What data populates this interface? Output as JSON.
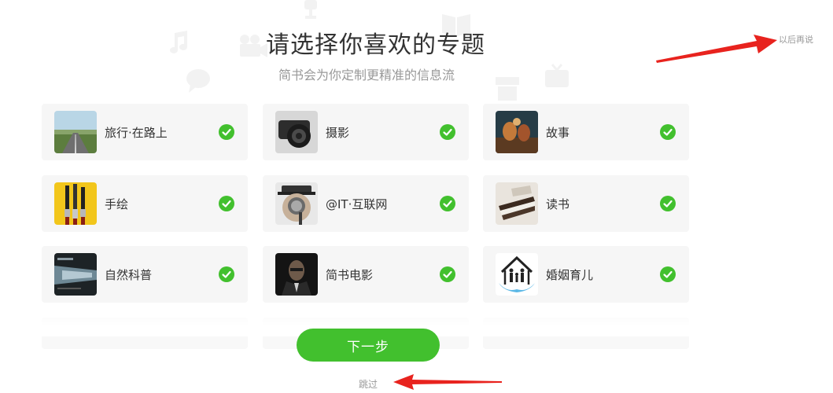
{
  "header": {
    "title": "请选择你喜欢的专题",
    "subtitle": "简书会为你定制更精准的信息流",
    "later_label": "以后再说"
  },
  "topics": [
    {
      "name": "旅行·在路上",
      "selected": true,
      "thumb": "road-photo"
    },
    {
      "name": "摄影",
      "selected": true,
      "thumb": "camera-photo"
    },
    {
      "name": "故事",
      "selected": true,
      "thumb": "theater-photo"
    },
    {
      "name": "手绘",
      "selected": true,
      "thumb": "paintbrush-photo"
    },
    {
      "name": "@IT·互联网",
      "selected": true,
      "thumb": "magnifier-man-photo"
    },
    {
      "name": "读书",
      "selected": true,
      "thumb": "books-photo"
    },
    {
      "name": "自然科普",
      "selected": true,
      "thumb": "tunnel-photo"
    },
    {
      "name": "简书电影",
      "selected": true,
      "thumb": "godfather-photo"
    },
    {
      "name": "婚姻育儿",
      "selected": true,
      "thumb": "family-house-logo"
    }
  ],
  "footer": {
    "next_label": "下一步",
    "skip_label": "跳过"
  },
  "colors": {
    "accent": "#42c02e",
    "annotation_arrow": "#e8231e",
    "card_bg": "#f6f6f6"
  }
}
